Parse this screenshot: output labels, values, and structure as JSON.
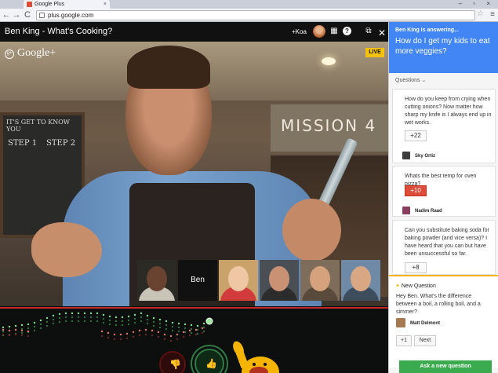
{
  "browser": {
    "tab_title": "Google Plus",
    "tab_close": "×",
    "window_controls": "– ▫ ×",
    "url": "plus.google.com",
    "back_icon": "←",
    "forward_icon": "→",
    "reload_icon": "C",
    "star_icon": "☆",
    "menu_icon": "≡"
  },
  "hangout": {
    "title": "Ben King - What's Cooking?",
    "user_label": "+Koa",
    "apps_icon": "▦",
    "help_icon": "?",
    "popout_icon": "⧉",
    "close_icon": "✕"
  },
  "video": {
    "brand": "Google+",
    "brand_icon": "g+",
    "live_badge": "LIVE",
    "mission_sign": "MISSION 4",
    "chalk_1": "IT'S GET TO KNOW YOU",
    "chalk_2": "STEP 1",
    "chalk_3": "STEP 2",
    "filmstrip": [
      {
        "name": ""
      },
      {
        "name": "Ben"
      },
      {
        "name": ""
      },
      {
        "name": ""
      },
      {
        "name": ""
      },
      {
        "name": ""
      }
    ]
  },
  "applause": {
    "dislike_icon": "👎",
    "like_icon": "👍"
  },
  "panel": {
    "answering_label": "Ben King is answering...",
    "current_question": "How do I get my kids to eat more veggies?",
    "questions_label": "Questions",
    "questions_chevron": "⌄",
    "questions": [
      {
        "text": "How do you keep from crying when cutting onions? Now matter how sharp my knife is I always end up in wet works.",
        "votes": "+22",
        "author": "Sky Ortiz"
      },
      {
        "text": "Whats the best temp for oven pizza?",
        "votes": "+10",
        "author": "Nadim Raad"
      },
      {
        "text": "Can you substitute baking soda for baking powder (and vice versa)? I have heard that you can but have been unsuccessful so far.",
        "votes": "+8",
        "author": ""
      }
    ],
    "new_question": {
      "label": "New Question",
      "icon": "✦",
      "text": "Hey Ben. What's the difference between a boil, a rolling boil, and a simmer?",
      "author": "Matt Delmont",
      "plus_one": "+1",
      "next": "Next"
    },
    "ask_button": "Ask a new question"
  },
  "colors": {
    "accent_blue": "#4285f4",
    "live_yellow": "#f4c20d",
    "vote_red": "#dd4b39",
    "ask_green": "#3bab4f"
  }
}
